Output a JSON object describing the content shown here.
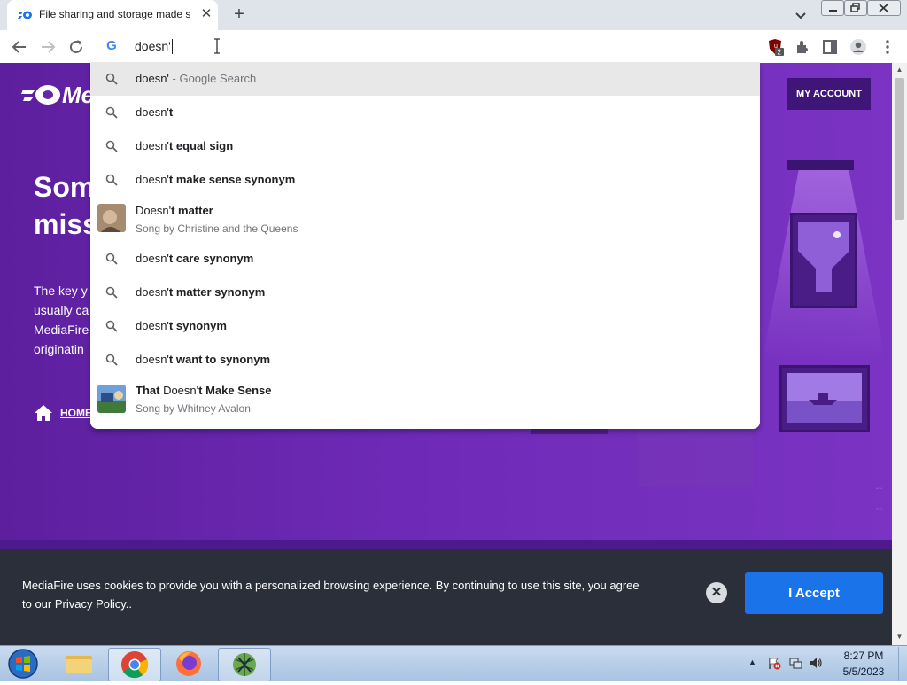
{
  "browser": {
    "tab": {
      "title": "File sharing and storage made si",
      "close_label": "✕"
    },
    "new_tab_label": "+",
    "omnibox": {
      "value": "doesn'"
    },
    "extension_badge": "2"
  },
  "suggestions": [
    {
      "type": "search",
      "text": "doesn'",
      "hint": " - Google Search"
    },
    {
      "type": "search",
      "prefix": "doesn'",
      "bold": "t"
    },
    {
      "type": "search",
      "prefix": "doesn'",
      "bold": "t equal sign"
    },
    {
      "type": "search",
      "prefix": "doesn'",
      "bold": "t make sense synonym"
    },
    {
      "type": "entity",
      "prefix": "Doesn'",
      "bold": "t matter",
      "subtitle": "Song by Christine and the Queens"
    },
    {
      "type": "search",
      "prefix": "doesn'",
      "bold": "t care synonym"
    },
    {
      "type": "search",
      "prefix": "doesn'",
      "bold": "t matter synonym"
    },
    {
      "type": "search",
      "prefix": "doesn'",
      "bold": "t synonym"
    },
    {
      "type": "search",
      "prefix": "doesn'",
      "bold": "t want to synonym"
    },
    {
      "type": "entity",
      "bold_lead": "That",
      "prefix": " Doesn'",
      "bold": "t Make Sense",
      "subtitle": "Song by Whitney Avalon"
    }
  ],
  "page": {
    "logo_text": "Me",
    "my_account_label": "MY ACCOUNT",
    "hero_title": "Som miss",
    "hero_body": "The key y\nusually ca\nMediaFire\noriginatin",
    "home_label": "HOME"
  },
  "cookie": {
    "text": "MediaFire uses cookies to provide you with a personalized browsing experience. By continuing to use this site, you agree to our Privacy Policy..",
    "close_label": "✕",
    "accept_label": "I Accept"
  },
  "taskbar": {
    "time": "8:27 PM",
    "date": "5/5/2023"
  },
  "colors": {
    "page_purple": "#6e2ab6",
    "accept_blue": "#1a73e8",
    "cookie_bg": "#2a2f3a"
  }
}
